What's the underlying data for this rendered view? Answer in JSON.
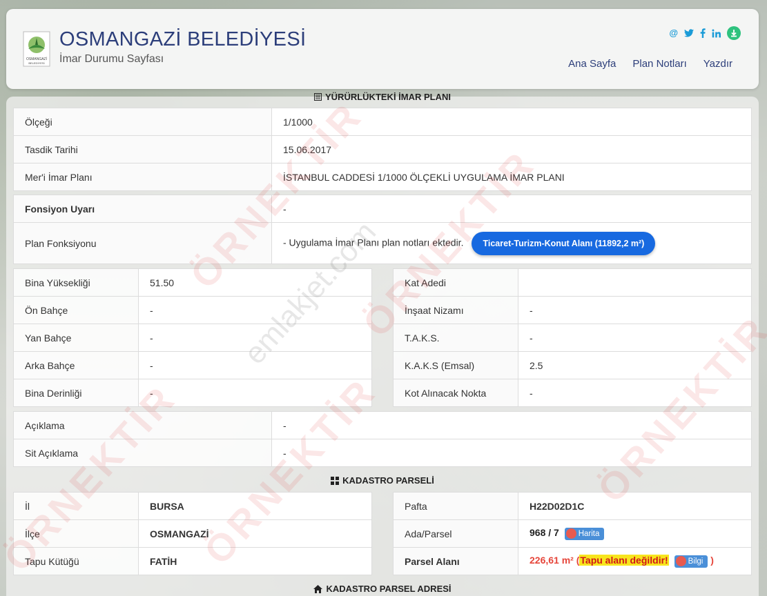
{
  "header": {
    "title": "OSMANGAZİ BELEDİYESİ",
    "subtitle": "İmar Durumu Sayfası",
    "logo_text": "OSMANGAZİ BELEDİYESİ",
    "nav": [
      "Ana Sayfa",
      "Plan Notları",
      "Yazdır"
    ]
  },
  "section_imar": {
    "title": "YÜRÜRLÜKTEKİ İMAR PLANI"
  },
  "plan_info": [
    {
      "label": "Ölçeği",
      "value": "1/1000"
    },
    {
      "label": "Tasdik Tarihi",
      "value": "15.06.2017"
    },
    {
      "label": "Mer'i İmar Planı",
      "value": "İSTANBUL CADDESİ 1/1000 ÖLÇEKLİ UYGULAMA İMAR PLANI"
    }
  ],
  "fonksiyon": {
    "uyari_label": "Fonsiyon Uyarı",
    "uyari_value": "-",
    "plan_label": "Plan Fonksiyonu",
    "plan_value": "- Uygulama İmar Planı plan notları ektedir.",
    "plan_button": "Ticaret-Turizm-Konut Alanı (11892,2 m²)"
  },
  "left_params": [
    {
      "label": "Bina Yüksekliği",
      "value": "51.50"
    },
    {
      "label": "Ön Bahçe",
      "value": "-"
    },
    {
      "label": "Yan Bahçe",
      "value": "-"
    },
    {
      "label": "Arka Bahçe",
      "value": "-"
    },
    {
      "label": "Bina Derinliği",
      "value": "-"
    }
  ],
  "right_params": [
    {
      "label": "Kat Adedi",
      "value": ""
    },
    {
      "label": "İnşaat Nizamı",
      "value": "-"
    },
    {
      "label": "T.A.K.S.",
      "value": "-"
    },
    {
      "label": "K.A.K.S (Emsal)",
      "value": "2.5"
    },
    {
      "label": "Kot Alınacak Nokta",
      "value": "-"
    }
  ],
  "notes": [
    {
      "label": "Açıklama",
      "value": "-"
    },
    {
      "label": "Sit Açıklama",
      "value": "-"
    }
  ],
  "section_kadastro": {
    "title": "KADASTRO PARSELİ"
  },
  "kadastro_left": [
    {
      "label": "İl",
      "value": "BURSA"
    },
    {
      "label": "İlçe",
      "value": "OSMANGAZİ"
    },
    {
      "label": "Tapu Kütüğü",
      "value": "FATİH"
    }
  ],
  "kadastro_right": {
    "pafta_label": "Pafta",
    "pafta_value": "H22D02D1C",
    "ada_label": "Ada/Parsel",
    "ada_value": "968 / 7",
    "harita_btn": "Harita",
    "alan_label": "Parsel Alanı",
    "alan_value": "226,61 m²",
    "alan_open": " (",
    "alan_warning": "Tapu alanı değildir!",
    "bilgi_btn": "Bilgi",
    "alan_close": " )"
  },
  "section_adres": {
    "title": "KADASTRO PARSEL ADRESİ"
  },
  "watermark": {
    "text": "ÖRNEKTİR",
    "site": "emlakjet.com"
  }
}
